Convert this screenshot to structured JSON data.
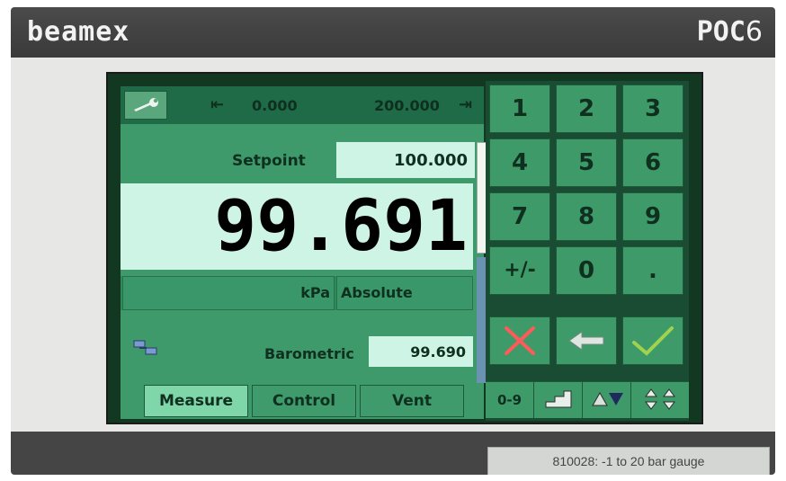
{
  "device": {
    "brand": "beamex",
    "model_prefix": "POC",
    "model_suffix": "6",
    "bottom_label": "810028: -1 to 20 bar gauge"
  },
  "range": {
    "min_icon": "⇤",
    "min_value": "0.000",
    "max_value": "200.000",
    "max_icon": "⇥"
  },
  "setpoint": {
    "label": "Setpoint",
    "value": "100.000"
  },
  "reading": {
    "value": "99.691",
    "unit": "kPa",
    "type": "Absolute"
  },
  "barometric": {
    "label": "Barometric",
    "value": "99.690"
  },
  "tabs": [
    {
      "label": "Measure",
      "active": true
    },
    {
      "label": "Control",
      "active": false
    },
    {
      "label": "Vent",
      "active": false
    }
  ],
  "keypad": {
    "keys": [
      "1",
      "2",
      "3",
      "4",
      "5",
      "6",
      "7",
      "8",
      "9",
      "+/-",
      "0",
      "."
    ],
    "mode_label": "0-9"
  },
  "icons": {
    "tool": "wrench-icon",
    "barometer": "barometer-icon",
    "cancel": "cancel-icon",
    "backspace": "backspace-arrow-icon",
    "confirm": "confirm-check-icon",
    "step": "step-icon",
    "up_down": "up-down-arrow-icon",
    "sort": "sort-icon"
  },
  "colors": {
    "accent_green": "#3f9a6a",
    "dark_green": "#1f6a47",
    "readout_bg": "#cdf4e4",
    "cancel_red": "#ff5a5a",
    "confirm_green": "#9fd34f"
  }
}
